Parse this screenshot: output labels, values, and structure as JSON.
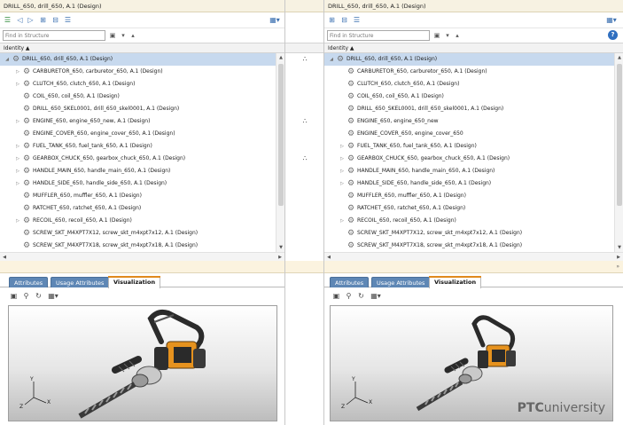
{
  "left": {
    "title": "DRILL_650, drill_650, A.1 (Design)",
    "find_placeholder": "Find in Structure",
    "column_header": "Identity ▲",
    "rows": [
      {
        "label": "DRILL_650, drill_650, A.1 (Design)",
        "level": 0,
        "expander": "◢",
        "selected": true
      },
      {
        "label": "CARBURETOR_650, carburetor_650, A.1 (Design)",
        "level": 1,
        "expander": "▷"
      },
      {
        "label": "CLUTCH_650, clutch_650, A.1 (Design)",
        "level": 1,
        "expander": "▷"
      },
      {
        "label": "COIL_650, coil_650, A.1 (Design)",
        "level": 1,
        "expander": ""
      },
      {
        "label": "DRILL_650_SKEL0001, drill_650_skel0001, A.1 (Design)",
        "level": 1,
        "expander": ""
      },
      {
        "label": "ENGINE_650, engine_650_new, A.1 (Design)",
        "level": 1,
        "expander": "▷"
      },
      {
        "label": "ENGINE_COVER_650, engine_cover_650, A.1 (Design)",
        "level": 1,
        "expander": ""
      },
      {
        "label": "FUEL_TANK_650, fuel_tank_650, A.1 (Design)",
        "level": 1,
        "expander": "▷"
      },
      {
        "label": "GEARBOX_CHUCK_650, gearbox_chuck_650, A.1 (Design)",
        "level": 1,
        "expander": "▷"
      },
      {
        "label": "HANDLE_MAIN_650, handle_main_650, A.1 (Design)",
        "level": 1,
        "expander": "▷"
      },
      {
        "label": "HANDLE_SIDE_650, handle_side_650, A.1 (Design)",
        "level": 1,
        "expander": "▷"
      },
      {
        "label": "MUFFLER_650, muffler_650, A.1 (Design)",
        "level": 1,
        "expander": ""
      },
      {
        "label": "RATCHET_650, ratchet_650, A.1 (Design)",
        "level": 1,
        "expander": ""
      },
      {
        "label": "RECOIL_650, recoil_650, A.1 (Design)",
        "level": 1,
        "expander": "▷"
      },
      {
        "label": "SCREW_SKT_M4XPT7X12, screw_skt_m4xpt7x12, A.1 (Design)",
        "level": 1,
        "expander": ""
      },
      {
        "label": "SCREW_SKT_M4XPT7X18, screw_skt_m4xpt7x18, A.1 (Design)",
        "level": 1,
        "expander": ""
      }
    ],
    "tabs": [
      "Attributes",
      "Usage Attributes",
      "Visualization"
    ]
  },
  "right": {
    "title": "DRILL_650, drill_650, A.1 (Design)",
    "find_placeholder": "Find in Structure",
    "column_header": "Identity ▲",
    "rows": [
      {
        "label": "DRILL_650, drill_650, A.1 (Design)",
        "level": 0,
        "expander": "◢",
        "selected": true
      },
      {
        "label": "CARBURETOR_650, carburetor_650, A.1 (Design)",
        "level": 1,
        "expander": ""
      },
      {
        "label": "CLUTCH_650, clutch_650, A.1 (Design)",
        "level": 1,
        "expander": ""
      },
      {
        "label": "COIL_650, coil_650, A.1 (Design)",
        "level": 1,
        "expander": ""
      },
      {
        "label": "DRILL_650_SKEL0001, drill_650_skel0001, A.1 (Design)",
        "level": 1,
        "expander": ""
      },
      {
        "label": "ENGINE_650, engine_650_new",
        "level": 1,
        "expander": ""
      },
      {
        "label": "ENGINE_COVER_650, engine_cover_650",
        "level": 1,
        "expander": ""
      },
      {
        "label": "FUEL_TANK_650, fuel_tank_650, A.1 (Design)",
        "level": 1,
        "expander": "▷"
      },
      {
        "label": "GEARBOX_CHUCK_650, gearbox_chuck_650, A.1 (Design)",
        "level": 1,
        "expander": "▷"
      },
      {
        "label": "HANDLE_MAIN_650, handle_main_650, A.1 (Design)",
        "level": 1,
        "expander": "▷"
      },
      {
        "label": "HANDLE_SIDE_650, handle_side_650, A.1 (Design)",
        "level": 1,
        "expander": "▷"
      },
      {
        "label": "MUFFLER_650, muffler_650, A.1 (Design)",
        "level": 1,
        "expander": ""
      },
      {
        "label": "RATCHET_650, ratchet_650, A.1 (Design)",
        "level": 1,
        "expander": ""
      },
      {
        "label": "RECOIL_650, recoil_650, A.1 (Design)",
        "level": 1,
        "expander": "▷"
      },
      {
        "label": "SCREW_SKT_M4XPT7X12, screw_skt_m4xpt7x12, A.1 (Design)",
        "level": 1,
        "expander": ""
      },
      {
        "label": "SCREW_SKT_M4XPT7X18, screw_skt_m4xpt7x18, A.1 (Design)",
        "level": 1,
        "expander": ""
      }
    ],
    "tabs": [
      "Attributes",
      "Usage Attributes",
      "Visualization"
    ]
  },
  "middle": {
    "marks": [
      "∴",
      "∴",
      "∴"
    ]
  },
  "viewer": {
    "triad_x": "X",
    "triad_y": "Y",
    "triad_z": "Z",
    "brand_prefix": "PTC",
    "brand_suffix": "university"
  },
  "icons": {
    "toolbar_left": [
      "compare-icon",
      "prev-icon",
      "next-icon",
      "tree-expand-icon",
      "tree-collapse-icon",
      "filter-icon"
    ],
    "find_buttons": [
      "binoculars-icon",
      "find-next-icon",
      "find-prev-icon"
    ],
    "viz_tools": [
      "zoom-fit-icon",
      "zoom-icon",
      "spin-icon",
      "view-options-icon"
    ],
    "gear": "part-gear-icon",
    "help": "help-icon"
  },
  "colors": {
    "title_bg": "#f7f2e2",
    "selection": "#c7d9ee",
    "tab_inactive": "#5e87b5",
    "tab_accent": "#e08a1e",
    "engine_orange": "#e6921e"
  }
}
